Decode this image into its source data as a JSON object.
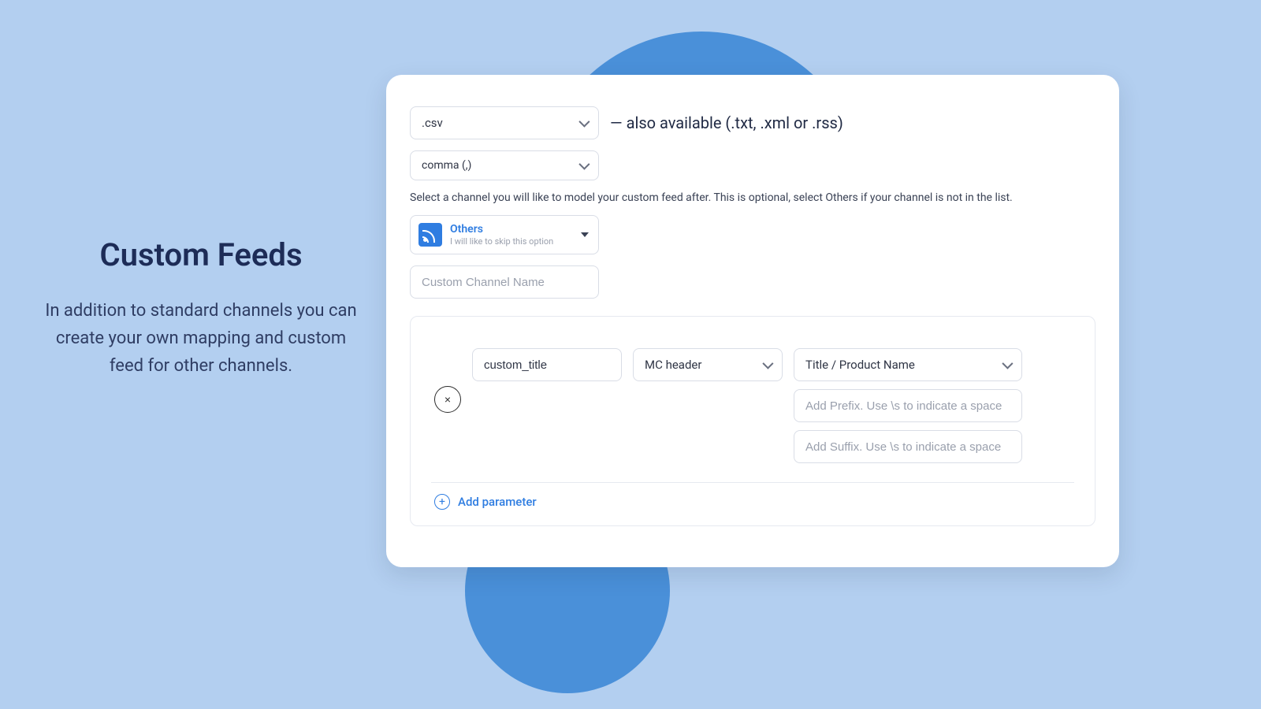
{
  "left": {
    "title": "Custom Feeds",
    "description": "In addition to standard channels you can create your own mapping and custom feed for other channels."
  },
  "form": {
    "file_type_selected": ".csv",
    "file_type_hint": "— also available (.txt, .xml or .rss)",
    "delimiter_selected": "comma (,)",
    "channel_help": "Select a channel you will like to model your custom feed after. This is optional, select Others if your channel is not in the list.",
    "channel": {
      "label": "Others",
      "sub": "I will like to skip this option"
    },
    "custom_channel_placeholder": "Custom Channel Name"
  },
  "mapping": {
    "field_value": "custom_title",
    "source_selected": "MC header",
    "target_selected": "Title / Product Name",
    "prefix_placeholder": "Add Prefix. Use \\s to indicate a space",
    "suffix_placeholder": "Add Suffix. Use \\s to indicate a space",
    "remove_symbol": "×"
  },
  "actions": {
    "add_parameter": "Add parameter",
    "plus": "+"
  }
}
